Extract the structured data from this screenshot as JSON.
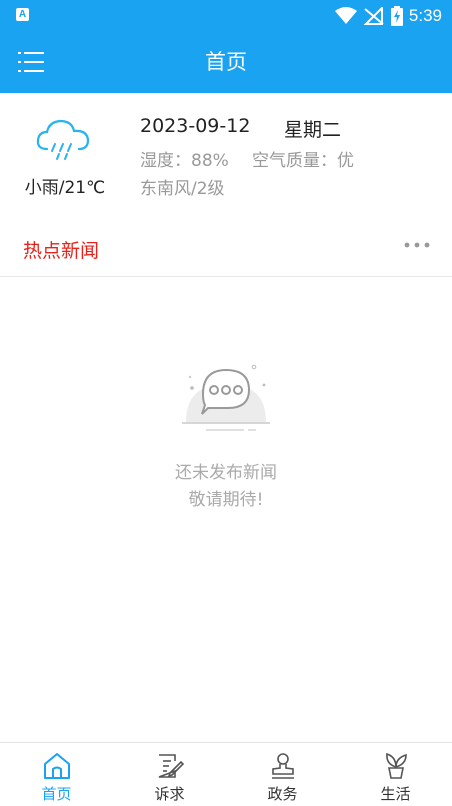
{
  "status_bar": {
    "app_badge": "A",
    "time": "5:39"
  },
  "app_bar": {
    "title": "首页"
  },
  "weather": {
    "condition": "小雨/21℃",
    "date": "2023-09-12",
    "weekday": "星期二",
    "humidity": "湿度：88%",
    "air_quality": "空气质量：优",
    "wind": "东南风/2级"
  },
  "news": {
    "section_title": "热点新闻",
    "empty_line1": "还未发布新闻",
    "empty_line2": "敬请期待!"
  },
  "tabs": [
    {
      "label": "首页",
      "icon": "home-icon",
      "active": true
    },
    {
      "label": "诉求",
      "icon": "edit-icon",
      "active": false
    },
    {
      "label": "政务",
      "icon": "stamp-icon",
      "active": false
    },
    {
      "label": "生活",
      "icon": "sprout-icon",
      "active": false
    }
  ],
  "colors": {
    "brand": "#1aa3f0",
    "news_title": "#e8221b",
    "muted_text": "#999999"
  }
}
